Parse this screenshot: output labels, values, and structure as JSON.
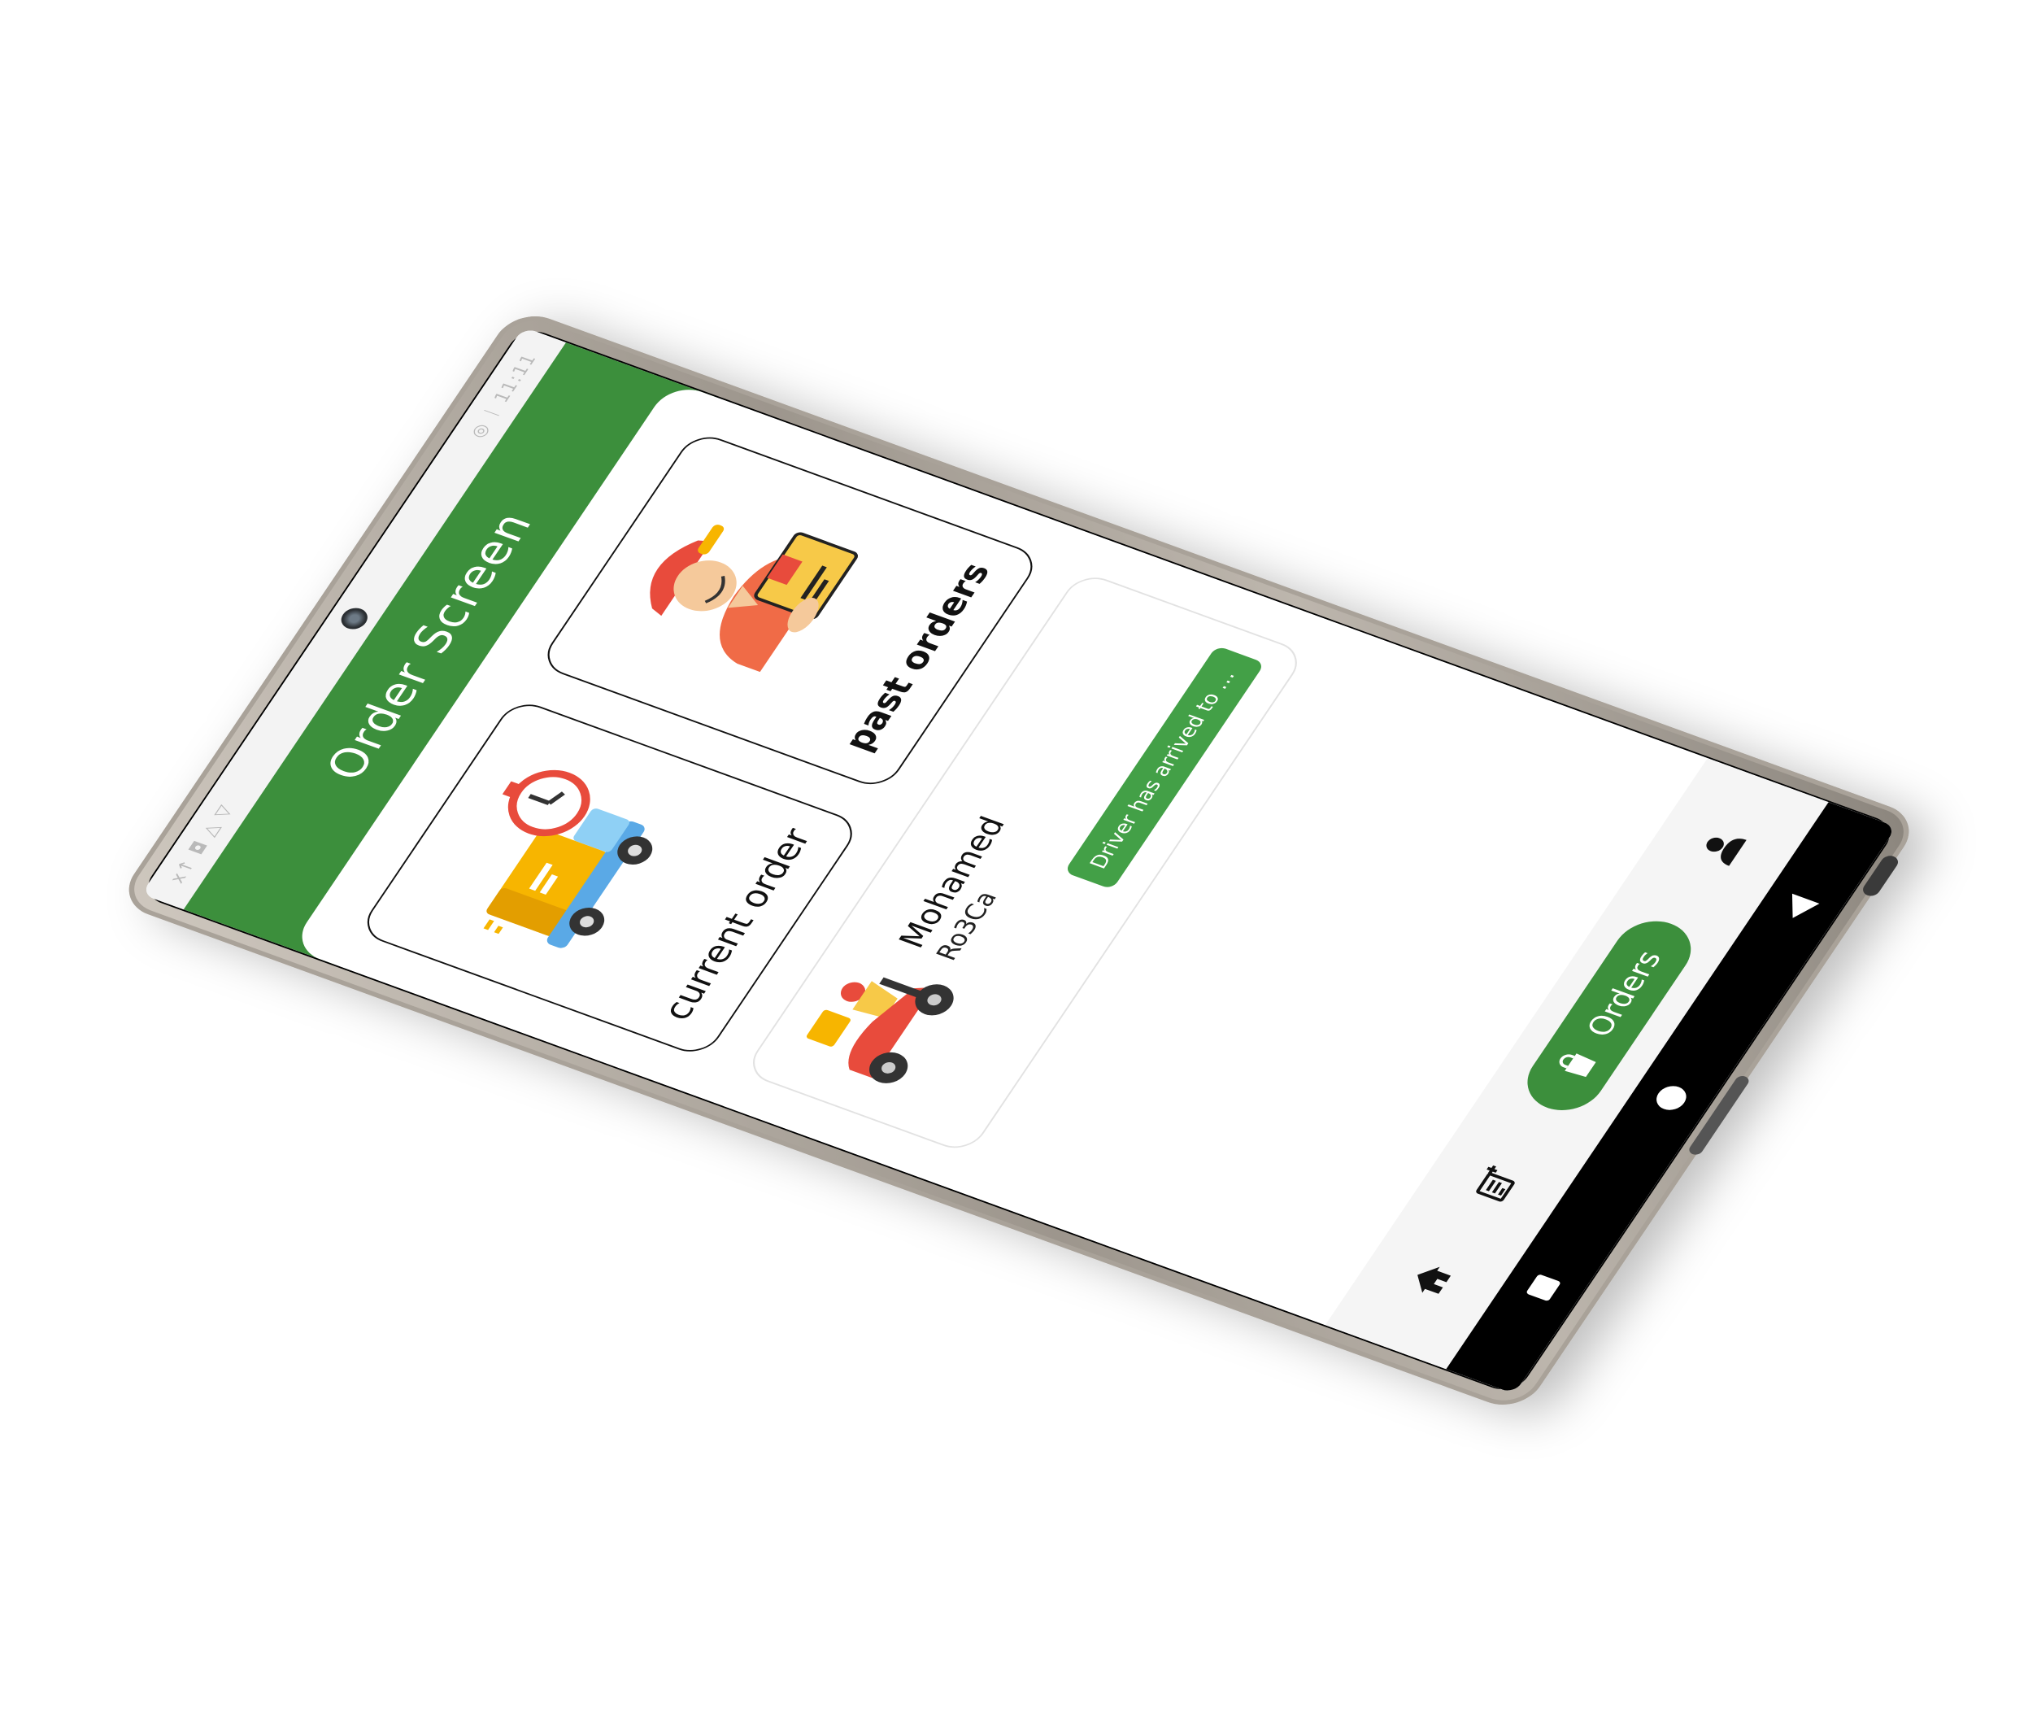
{
  "status_bar": {
    "left_icons": "x↑ ◘ △ ▽",
    "right_text": "◎  ᛁ 11:11"
  },
  "header": {
    "title": "Order Screen"
  },
  "cards": {
    "current_order": {
      "label": "current order",
      "icon": "delivery-truck-timer-icon"
    },
    "past_orders": {
      "label": "past orders",
      "icon": "courier-with-box-icon"
    }
  },
  "order_item": {
    "driver_name": "Mohamed",
    "driver_code": "Ro3Ca",
    "status": "Driver has arrived to pi...",
    "icon": "delivery-scooter-icon"
  },
  "bottom_nav": {
    "items": [
      {
        "icon": "home-icon"
      },
      {
        "icon": "note-add-icon"
      },
      {
        "icon": "shopping-bag-icon",
        "label": "Orders"
      },
      {
        "icon": "person-icon"
      }
    ]
  },
  "colors": {
    "primary_green": "#3c8f3c",
    "badge_green": "#43a047",
    "screen_bg": "#ffffff"
  }
}
